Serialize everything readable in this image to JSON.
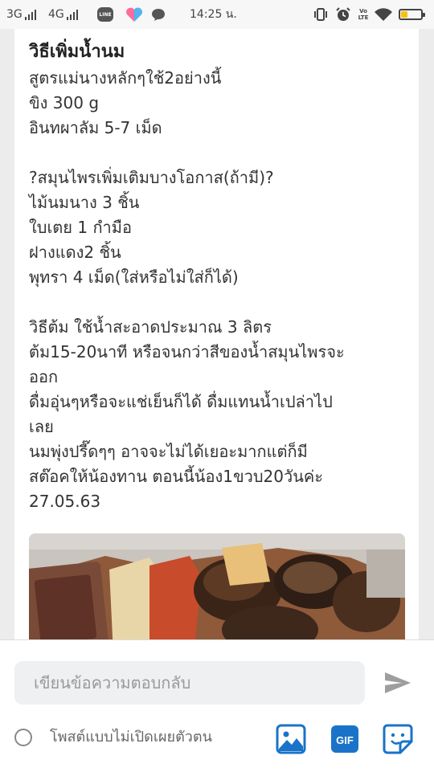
{
  "status_bar": {
    "network1": "3G",
    "network2": "4G",
    "line_badge": "LINE",
    "time": "14:25 น.",
    "volte": "Vo LTE",
    "battery_level": 0.35,
    "battery_color": "#f4c20d"
  },
  "post": {
    "title": "วิธีเพิ่มน้ำนม",
    "lines": [
      "สูตรแม่นางหลักๆใช้2อย่างนี้",
      "ขิง 300 g",
      "อินทผาลัม 5-7 เม็ด",
      "",
      "?สมุนไพรเพิ่มเติมบางโอกาส(ถ้ามี)?",
      "ไม้นมนาง 3 ชิ้น",
      "ใบเตย 1 กำมือ",
      "ฝางแดง2 ชิ้น",
      "พุทรา 4 เม็ด(ใส่หรือไม่ใส่ก็ได้)",
      "",
      "วิธีต้ม ใช้น้ำสะอาดประมาณ 3 ลิตร",
      "ต้ม15-20นาที หรือจนกว่าสีของน้ำสมุนไพรจะ",
      "ออก",
      "ดื่มอุ่นๆหรือจะแช่เย็นก็ได้ ดื่มแทนน้ำเปล่าไป",
      "เลย",
      "นมพุ่งปรี๊ดๆๆ อาจจะไม่ได้เยอะมากแต่ก็มี",
      "สต๊อคให้น้องทาน ตอนนี้น้อง1ขวบ20วันค่ะ",
      "27.05.63"
    ]
  },
  "reply": {
    "placeholder": "เขียนข้อความตอบกลับ",
    "anonymous_label": "โพสต์แบบไม่เปิดเผยตัวตน",
    "gif_label": "GIF",
    "accent_color": "#1a73c8",
    "send_color": "#9e9e9e"
  }
}
